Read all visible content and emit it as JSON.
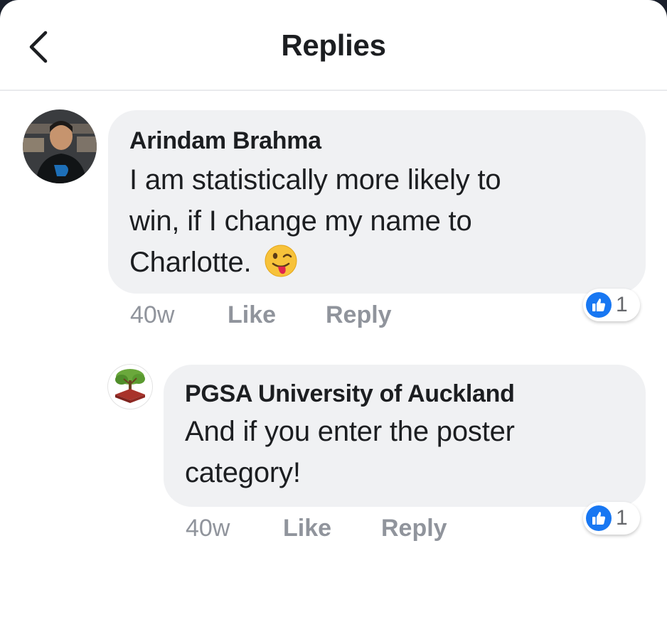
{
  "header": {
    "title": "Replies",
    "back_icon": "chevron-left-icon"
  },
  "colors": {
    "bubble": "#f0f1f3",
    "like_blue": "#1877f2",
    "meta_gray": "#90949c",
    "text": "#1c1e21"
  },
  "comments": [
    {
      "author": "Arindam Brahma",
      "text_lines": [
        "I am statistically more likely to",
        "win, if I change my name to",
        "Charlotte."
      ],
      "emoji": "winking-tongue-emoji",
      "time": "40w",
      "like_label": "Like",
      "reply_label": "Reply",
      "reaction_count": "1"
    },
    {
      "author": "PGSA University of Auckland",
      "text_lines": [
        "And if you enter the poster",
        "category!"
      ],
      "time": "40w",
      "like_label": "Like",
      "reply_label": "Reply",
      "reaction_count": "1"
    }
  ]
}
